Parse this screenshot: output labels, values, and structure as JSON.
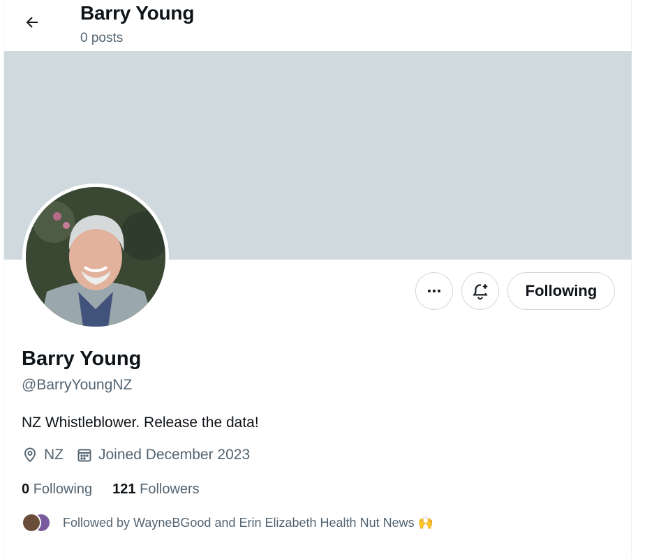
{
  "header": {
    "name": "Barry Young",
    "post_count": "0 posts"
  },
  "profile": {
    "display_name": "Barry Young",
    "handle": "@BarryYoungNZ",
    "bio": "NZ Whistleblower. Release the data!",
    "location": "NZ",
    "joined": "Joined December 2023",
    "following_count": "0",
    "following_label": "Following",
    "followers_count": "121",
    "followers_label": "Followers",
    "followed_by": "Followed by WayneBGood and Erin Elizabeth Health Nut News 🙌"
  },
  "actions": {
    "following_button": "Following",
    "more_icon": "more-icon",
    "notify_icon": "bell-plus-icon"
  },
  "colors": {
    "banner": "#cfd9de",
    "secondary_text": "#536471",
    "primary_text": "#0f1419",
    "border": "#cfd9de"
  }
}
